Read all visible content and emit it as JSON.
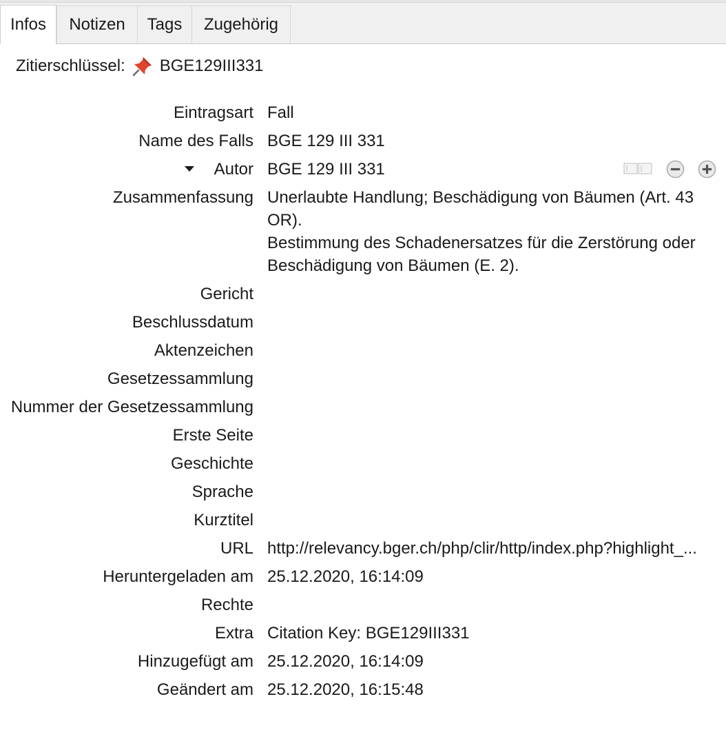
{
  "tabs": [
    {
      "label": "Infos"
    },
    {
      "label": "Notizen"
    },
    {
      "label": "Tags"
    },
    {
      "label": "Zugehörig"
    }
  ],
  "citation": {
    "label": "Zitierschlüssel:",
    "key": "BGE129III331",
    "icon": "pushpin-icon",
    "icon_color": "#e0452f"
  },
  "fields": {
    "item_type": {
      "label": "Eintragsart",
      "value": "Fall"
    },
    "case_name": {
      "label": "Name des Falls",
      "value": "BGE 129 III 331"
    },
    "author": {
      "label": "Autor",
      "value": "BGE 129 III 331"
    },
    "abstract": {
      "label": "Zusammenfassung",
      "value": "Unerlaubte Handlung; Beschädigung von Bäumen (Art. 43 OR).\nBestimmung des Schadenersatzes für die Zerstörung oder Beschädigung von Bäumen (E. 2)."
    },
    "court": {
      "label": "Gericht",
      "value": ""
    },
    "date_decided": {
      "label": "Beschlussdatum",
      "value": ""
    },
    "docket": {
      "label": "Aktenzeichen",
      "value": ""
    },
    "reporter": {
      "label": "Gesetzessammlung",
      "value": ""
    },
    "reporter_volume": {
      "label": "Nummer der Gesetzessammlung",
      "value": ""
    },
    "first_page": {
      "label": "Erste Seite",
      "value": ""
    },
    "history": {
      "label": "Geschichte",
      "value": ""
    },
    "language": {
      "label": "Sprache",
      "value": ""
    },
    "short_title": {
      "label": "Kurztitel",
      "value": ""
    },
    "url": {
      "label": "URL",
      "value": "http://relevancy.bger.ch/php/clir/http/index.php?highlight_..."
    },
    "accessed": {
      "label": "Heruntergeladen am",
      "value": "25.12.2020, 16:14:09"
    },
    "rights": {
      "label": "Rechte",
      "value": ""
    },
    "extra": {
      "label": "Extra",
      "value": "Citation Key: BGE129III331"
    },
    "date_added": {
      "label": "Hinzugefügt am",
      "value": "25.12.2020, 16:14:09"
    },
    "date_modified": {
      "label": "Geändert am",
      "value": "25.12.2020, 16:15:48"
    }
  },
  "author_controls": {
    "swap_icon": "swap-name-format-icon",
    "minus_icon": "minus-circle-icon",
    "plus_icon": "plus-circle-icon",
    "expand_icon": "triangle-down-icon"
  }
}
